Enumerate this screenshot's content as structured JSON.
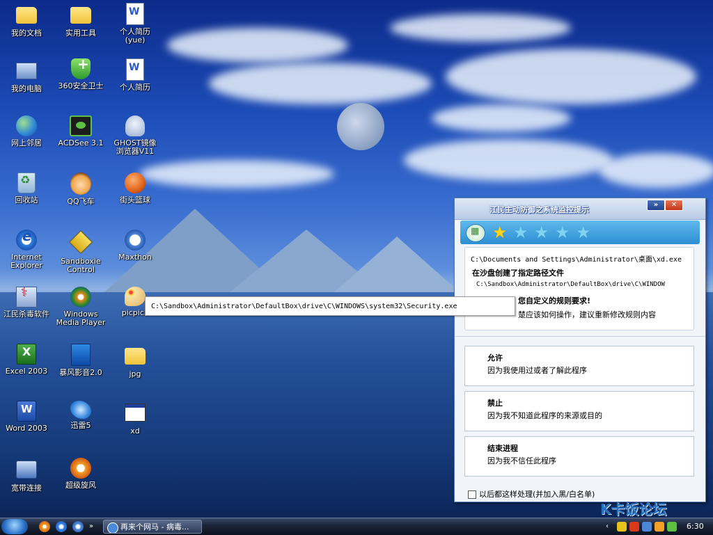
{
  "desktop": {
    "icons": [
      {
        "label": "我的文档",
        "icon": "folder-icon"
      },
      {
        "label": "实用工具",
        "icon": "folder-icon"
      },
      {
        "label": "个人简历(yue)",
        "icon": "word-document-icon"
      },
      {
        "label": "我的电脑",
        "icon": "computer-icon"
      },
      {
        "label": "360安全卫士",
        "icon": "360-shield-icon"
      },
      {
        "label": "个人简历",
        "icon": "word-document-icon"
      },
      {
        "label": "网上邻居",
        "icon": "network-places-icon"
      },
      {
        "label": "ACDSee 3.1",
        "icon": "acdsee-eye-icon"
      },
      {
        "label": "GHOST镜像浏览器V11",
        "icon": "ghost-icon"
      },
      {
        "label": "回收站",
        "icon": "recycle-bin-icon"
      },
      {
        "label": "QQ飞车",
        "icon": "qq-speed-icon"
      },
      {
        "label": "街头篮球",
        "icon": "basketball-icon"
      },
      {
        "label": "Internet Explorer",
        "icon": "internet-explorer-icon"
      },
      {
        "label": "Sandboxie Control",
        "icon": "sandboxie-icon"
      },
      {
        "label": "Maxthon",
        "icon": "maxthon-icon"
      },
      {
        "label": "江民杀毒软件",
        "icon": "jiangmin-antivirus-icon"
      },
      {
        "label": "Windows Media Player",
        "icon": "media-player-icon"
      },
      {
        "label": "picpick",
        "icon": "palette-icon"
      },
      {
        "label": "Excel 2003",
        "icon": "excel-icon"
      },
      {
        "label": "暴风影音2.0",
        "icon": "baofeng-player-icon"
      },
      {
        "label": "jpg",
        "icon": "folder-icon"
      },
      {
        "label": "Word 2003",
        "icon": "word-icon"
      },
      {
        "label": "迅雷5",
        "icon": "thunder-icon"
      },
      {
        "label": "xd",
        "icon": "window-program-icon"
      },
      {
        "label": "宽带连接",
        "icon": "broadband-icon"
      },
      {
        "label": "超级旋风",
        "icon": "tornado-icon"
      }
    ]
  },
  "tooltip": {
    "text": "C:\\Sandbox\\Administrator\\DefaultBox\\drive\\C\\WINDOWS\\system32\\Security.exe"
  },
  "popup": {
    "title": "江民主动防御之系统监控提示",
    "btn_min": "»",
    "btn_close": "✕",
    "rating": {
      "filled": 1,
      "total": 5
    },
    "info": {
      "program_path": "C:\\Documents and Settings\\Administrator\\桌面\\xd.exe",
      "message": "在沙盘创建了指定路径文件",
      "target_path": "C:\\Sandbox\\Administrator\\DefaultBox\\drive\\C\\WINDOW",
      "rule_line": "您自定义的规则要求!",
      "hint_line": "楚应该如何操作，建议重新修改规则内容"
    },
    "options": [
      {
        "title": "允许",
        "desc": "因为我使用过或者了解此程序"
      },
      {
        "title": "禁止",
        "desc": "因为我不知道此程序的来源或目的"
      },
      {
        "title": "结束进程",
        "desc": "因为我不信任此程序"
      }
    ],
    "checkbox_label": "以后都这样处理(并加入黑/白名单)"
  },
  "watermark": {
    "text": "K卡饭论坛"
  },
  "taskbar": {
    "task_label": "再来个网马 - 病毒...",
    "clock": "6:30"
  },
  "colors": {
    "popup_accent": "#2d8ed2",
    "star_on": "#ffd21a",
    "star_off": "#7fd4f2"
  }
}
